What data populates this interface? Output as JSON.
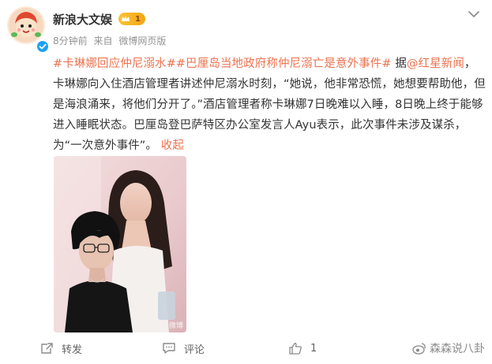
{
  "account": {
    "name": "新浪大文娱",
    "vip_level": "1",
    "avatar_icon": "cartoon-avatar-icon"
  },
  "meta": {
    "time": "8分钟前",
    "source_prefix": "来自",
    "source": "微博网页版"
  },
  "post": {
    "topic1": "#卡琳娜回应仲尼溺水#",
    "topic2": "#巴厘岛当地政府称仲尼溺亡是意外事件#",
    "ref_prefix": " 据",
    "mention": "@红星新闻",
    "body": "，卡琳娜向入住酒店管理者讲述仲尼溺水时刻，“她说，他非常恐慌，她想要帮助他，但是海浪涌来，将他们分开了。”酒店管理者称卡琳娜7日晚难以入睡，8日晚上终于能够进入睡眠状态。巴厘岛登巴萨特区办公室发言人Ayu表示，此次事件未涉及谋杀，为“一次意外事件”。",
    "collapse_label": "收起"
  },
  "image": {
    "alt": "",
    "watermark": "微博"
  },
  "actions": {
    "repost_label": "转发",
    "comment_label": "评论",
    "like_count": "1"
  },
  "watermark": {
    "text": "森森说八卦"
  },
  "colors": {
    "link": "#eb7350",
    "text": "#333333",
    "meta": "#939393",
    "vip": "#f4a616",
    "verified": "#1da0f2"
  }
}
